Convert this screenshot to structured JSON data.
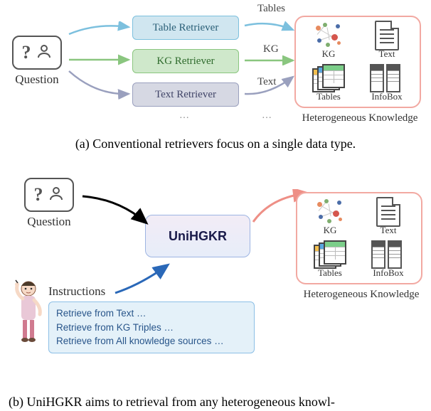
{
  "panel_a": {
    "question_label": "Question",
    "retrievers": {
      "table": "Table Retriever",
      "kg": "KG Retriever",
      "text": "Text Retriever"
    },
    "edge_labels": {
      "tables": "Tables",
      "kg": "KG",
      "text": "Text"
    },
    "caption": "(a) Conventional retrievers focus on a single data type."
  },
  "panel_b": {
    "question_label": "Question",
    "model_name": "UniHGKR",
    "instructions_label": "Instructions",
    "instructions": {
      "l1": "Retrieve from Text …",
      "l2": "Retrieve from KG Triples …",
      "l3": "Retrieve from All knowledge sources …"
    },
    "caption": "(b) UniHGKR aims to retrieval from any heterogeneous knowl-"
  },
  "knowledge": {
    "kg": "KG",
    "text": "Text",
    "tables": "Tables",
    "infobox": "InfoBox",
    "caption": "Heterogeneous Knowledge"
  }
}
